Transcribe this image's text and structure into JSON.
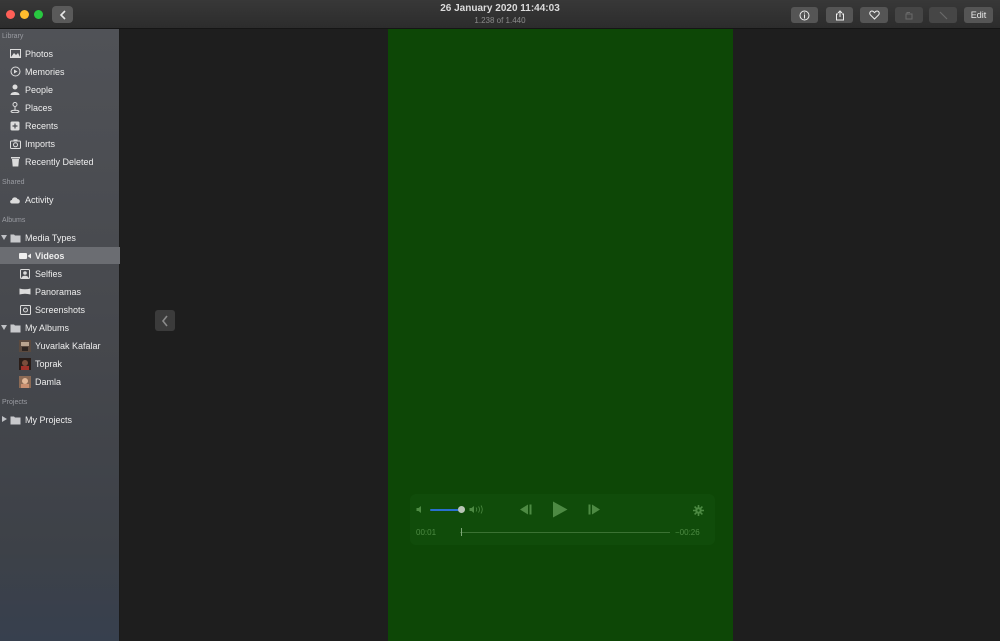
{
  "window": {
    "title": "26 January 2020 11:44:03",
    "subtitle": "1.238 of 1.440"
  },
  "toolbar": {
    "edit_label": "Edit",
    "buttons": [
      "info-icon",
      "share-icon",
      "heart-icon",
      "rotate-icon",
      "enhance-icon"
    ]
  },
  "sidebar": {
    "sections": {
      "library": "Library",
      "shared": "Shared",
      "albums": "Albums",
      "projects": "Projects"
    },
    "library_items": [
      {
        "label": "Photos",
        "icon": "photos-icon"
      },
      {
        "label": "Memories",
        "icon": "memories-icon"
      },
      {
        "label": "People",
        "icon": "people-icon"
      },
      {
        "label": "Places",
        "icon": "places-icon"
      },
      {
        "label": "Recents",
        "icon": "recents-icon"
      },
      {
        "label": "Imports",
        "icon": "imports-icon"
      },
      {
        "label": "Recently Deleted",
        "icon": "trash-icon"
      }
    ],
    "shared_items": [
      {
        "label": "Activity",
        "icon": "cloud-icon"
      }
    ],
    "albums": {
      "media_types": {
        "label": "Media Types",
        "children": [
          {
            "label": "Videos",
            "icon": "video-icon",
            "selected": true
          },
          {
            "label": "Selfies",
            "icon": "selfie-icon"
          },
          {
            "label": "Panoramas",
            "icon": "panorama-icon"
          },
          {
            "label": "Screenshots",
            "icon": "screenshot-icon"
          }
        ]
      },
      "my_albums": {
        "label": "My Albums",
        "children": [
          {
            "label": "Yuvarlak Kafalar",
            "icon": "album-thumbnail"
          },
          {
            "label": "Toprak",
            "icon": "album-thumbnail"
          },
          {
            "label": "Damla",
            "icon": "album-thumbnail"
          }
        ]
      }
    },
    "projects": {
      "my_projects": {
        "label": "My Projects"
      }
    }
  },
  "player": {
    "elapsed": "00:01",
    "remaining": "−00:26",
    "volume": 0.85,
    "progress": 0.04
  },
  "colors": {
    "video_background": "#0d4706",
    "sidebar_selection": "#6b6d72",
    "volume_accent": "#2a6fd0"
  }
}
